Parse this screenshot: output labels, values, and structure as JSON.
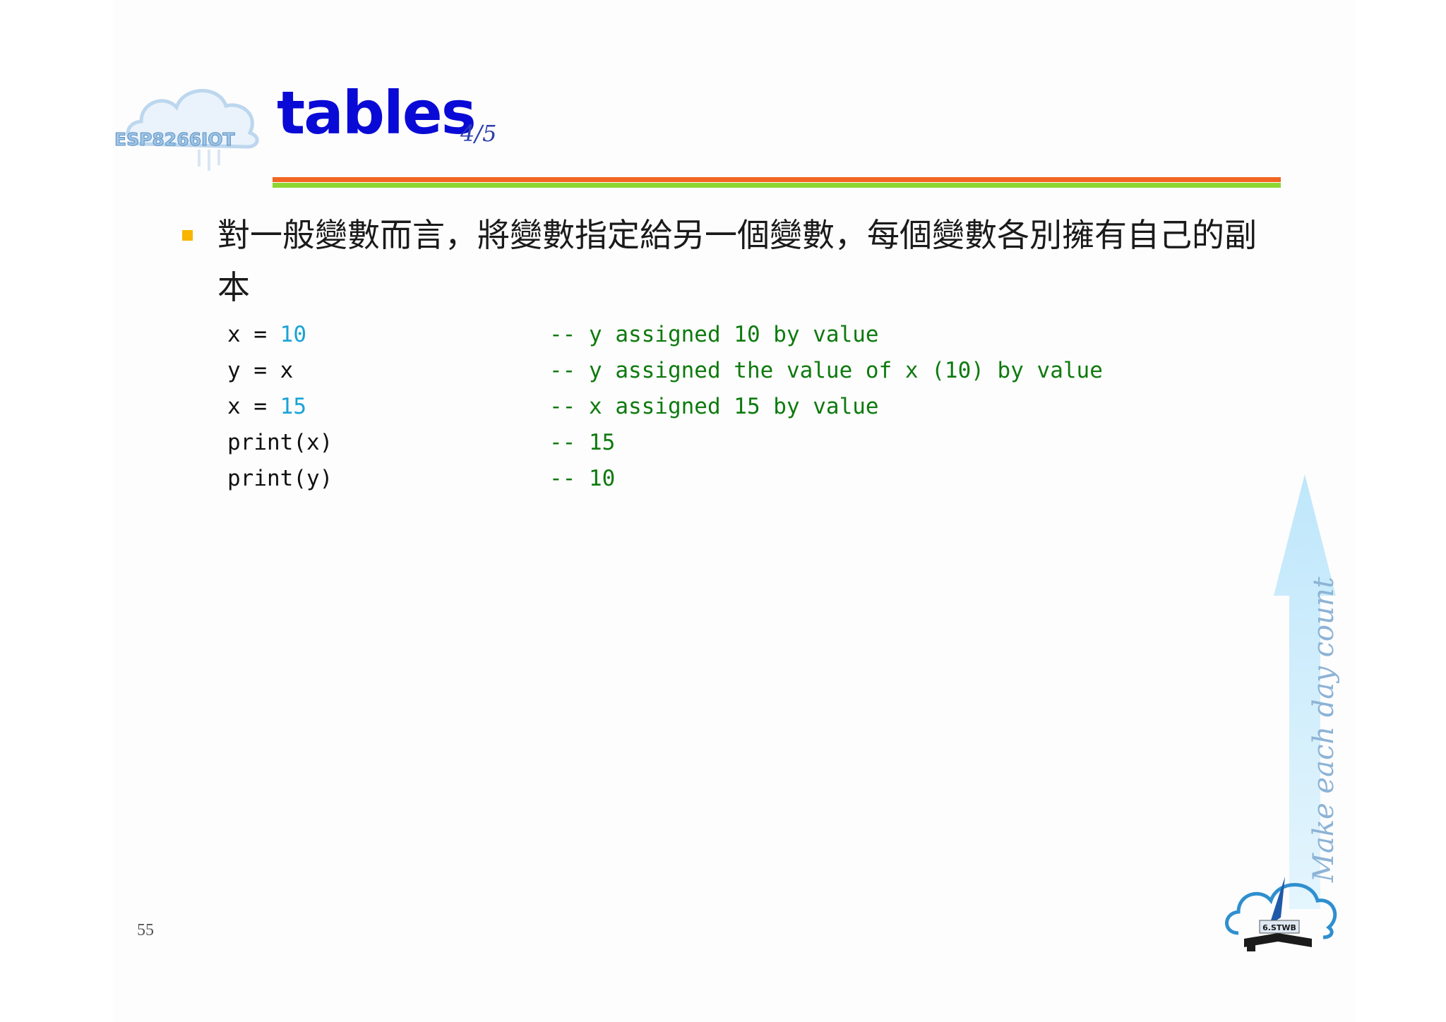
{
  "slide": {
    "logo_text": "ESP8266IOT",
    "title": "tables",
    "page_fraction": "4/5",
    "bullet": "對一般變數而言，將變數指定給另一個變數，每個變數各別擁有自己的副本",
    "code": [
      {
        "parts": [
          "x = ",
          "10"
        ],
        "comment": "-- y assigned 10 by value"
      },
      {
        "parts": [
          "y = x",
          ""
        ],
        "comment": "-- y assigned the value of x (10) by value"
      },
      {
        "parts": [
          "x = ",
          "15"
        ],
        "comment": "-- x assigned 15 by value"
      },
      {
        "parts": [
          "print(x)",
          ""
        ],
        "comment": "-- 15"
      },
      {
        "parts": [
          "print(y)",
          ""
        ],
        "comment": "-- 10"
      }
    ],
    "page_number": "55",
    "motto": "Make each day count",
    "badge_text": "6.STWB"
  },
  "colors": {
    "title": "#0a0ad6",
    "rule_top": "#f26522",
    "rule_bottom": "#8dd631",
    "bullet": "#f7b500",
    "number": "#1aa3d6",
    "comment": "#0e7a0e"
  },
  "icons": [
    "cloud-logo-icon",
    "arrow-up-icon",
    "cloud-book-quill-icon"
  ]
}
